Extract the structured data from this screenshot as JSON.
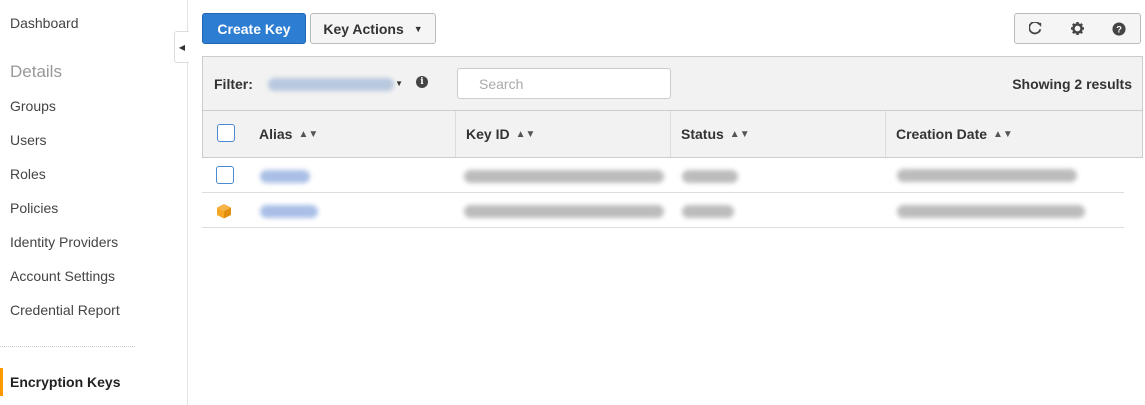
{
  "sidebar": {
    "dashboard": "Dashboard",
    "heading": "Details",
    "items": [
      {
        "label": "Groups"
      },
      {
        "label": "Users"
      },
      {
        "label": "Roles"
      },
      {
        "label": "Policies"
      },
      {
        "label": "Identity Providers"
      },
      {
        "label": "Account Settings"
      },
      {
        "label": "Credential Report"
      }
    ],
    "active": "Encryption Keys"
  },
  "toolbar": {
    "create_label": "Create Key",
    "actions_label": "Key Actions",
    "icons": [
      "refresh-icon",
      "gear-icon",
      "help-icon"
    ]
  },
  "filter": {
    "label": "Filter:",
    "search_placeholder": "Search",
    "results": "Showing 2 results"
  },
  "table": {
    "columns": [
      "Alias",
      "Key ID",
      "Status",
      "Creation Date"
    ]
  },
  "colors": {
    "primary": "#2d7dd2",
    "active_accent": "#ff9900",
    "aws_managed_icon": "#f5a623"
  }
}
